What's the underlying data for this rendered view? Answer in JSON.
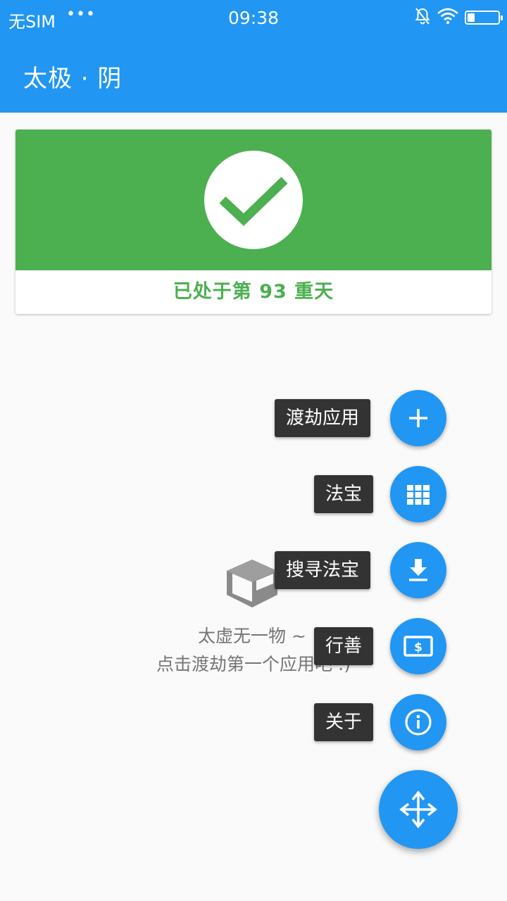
{
  "status_bar": {
    "carrier": "无SIM",
    "dots": "•••",
    "time": "09:38",
    "icons": [
      "bell-off-icon",
      "wifi-icon",
      "battery-icon"
    ]
  },
  "app_bar": {
    "title": "太极 · 阴"
  },
  "status_card": {
    "message": "已处于第 93 重天",
    "color": "#4caf50",
    "icon": "check-icon"
  },
  "empty_state": {
    "icon": "box-icon",
    "line1": "太虚无一物 ~",
    "line2": "点击渡劫第一个应用吧 :)"
  },
  "fab_menu": {
    "items": [
      {
        "label": "渡劫应用",
        "icon": "plus-icon"
      },
      {
        "label": "法宝",
        "icon": "grid-icon"
      },
      {
        "label": "搜寻法宝",
        "icon": "download-icon"
      },
      {
        "label": "行善",
        "icon": "donate-icon"
      },
      {
        "label": "关于",
        "icon": "info-icon"
      }
    ],
    "main_icon": "move-arrows-icon"
  },
  "colors": {
    "primary": "#2196f3",
    "success": "#4caf50",
    "label_bg": "#333333",
    "background": "#fafafa"
  }
}
